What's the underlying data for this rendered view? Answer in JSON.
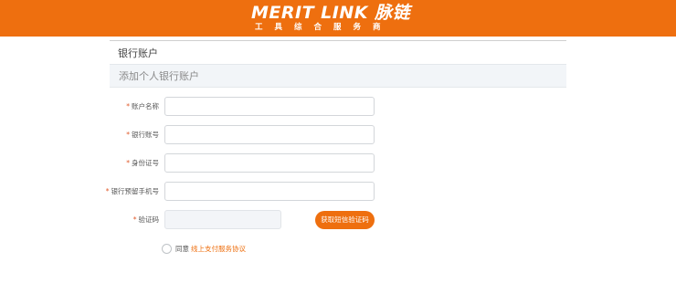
{
  "header": {
    "brand_name": "MERIT LINK 脉链",
    "brand_tagline": "工具综合服务商"
  },
  "page": {
    "section_title": "银行账户",
    "subheading": "添加个人银行账户"
  },
  "form": {
    "fields": [
      {
        "required_mark": "*",
        "label": "账户名称",
        "value": ""
      },
      {
        "required_mark": "*",
        "label": "银行账号",
        "value": ""
      },
      {
        "required_mark": "*",
        "label": "身份证号",
        "value": ""
      },
      {
        "required_mark": "*",
        "label": "银行预留手机号",
        "value": ""
      },
      {
        "required_mark": "*",
        "label": "验证码",
        "value": ""
      }
    ],
    "sms_button_label": "获取短信验证码",
    "agree_label": "同意",
    "agreement_link": "线上支付服务协议"
  },
  "colors": {
    "brand_orange": "#ee6f0f",
    "required_red": "#e05a2a",
    "subhead_bg": "#f2f5f8"
  }
}
